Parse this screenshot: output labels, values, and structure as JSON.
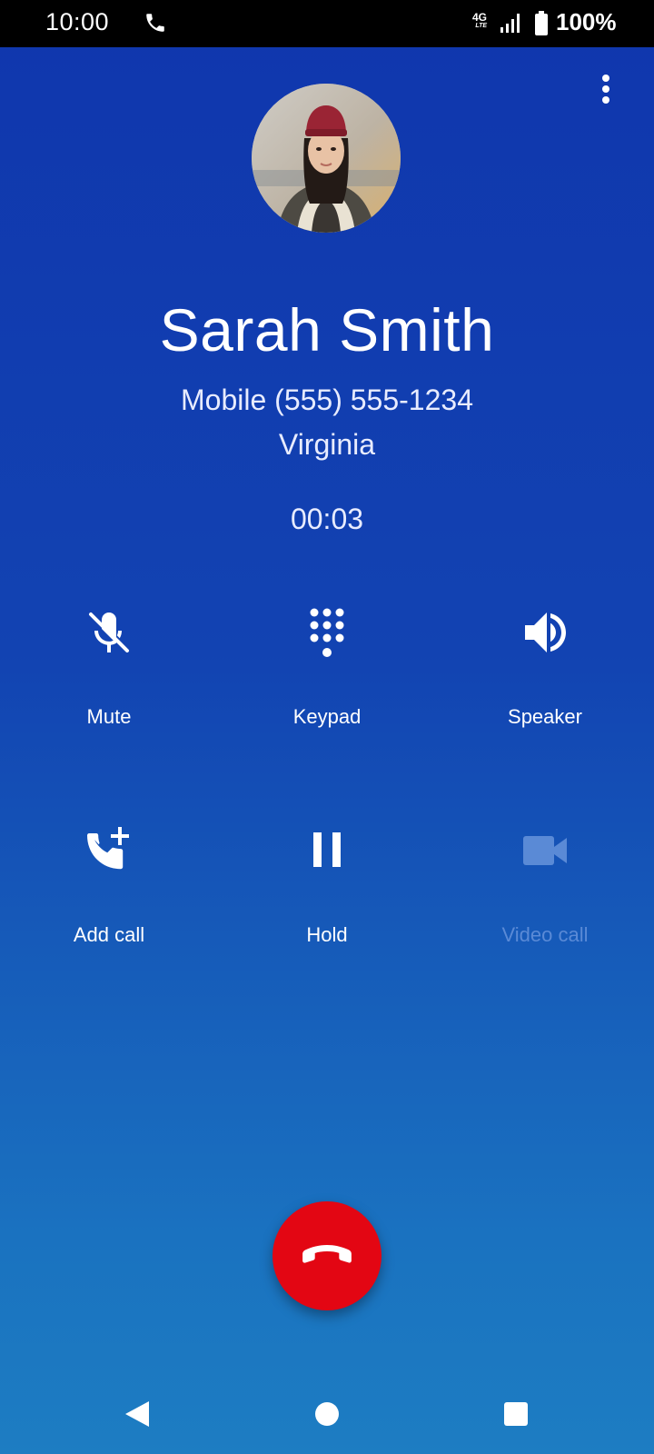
{
  "status_bar": {
    "time": "10:00",
    "network": "4G",
    "network_sub": "LTE",
    "battery": "100%"
  },
  "call": {
    "contact_name": "Sarah Smith",
    "number_line": "Mobile (555) 555-1234",
    "location": "Virginia",
    "duration": "00:03"
  },
  "actions": {
    "mute": "Mute",
    "keypad": "Keypad",
    "speaker": "Speaker",
    "add_call": "Add call",
    "hold": "Hold",
    "video_call": "Video call"
  },
  "colors": {
    "end_call": "#e30613",
    "background_top": "#1036ad",
    "background_bottom": "#1d7dc2",
    "disabled_label": "#5a8ad6"
  },
  "icons": {
    "status_phone": "phone-icon",
    "menu": "more-vert-icon",
    "mute": "mic-off-icon",
    "keypad": "dialpad-icon",
    "speaker": "volume-up-icon",
    "add_call": "add-call-icon",
    "hold": "pause-icon",
    "video_call": "videocam-icon",
    "end_call": "call-end-icon"
  }
}
